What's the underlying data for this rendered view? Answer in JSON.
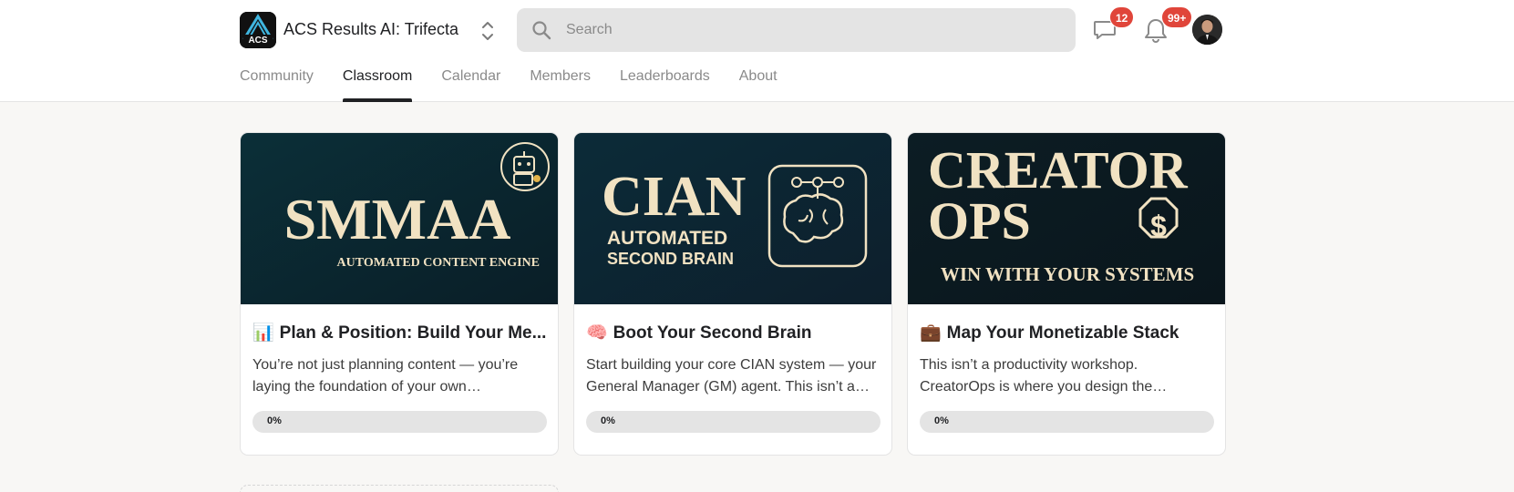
{
  "header": {
    "group_name": "ACS Results AI: Trifecta",
    "logo_text": "ACS",
    "search": {
      "placeholder": "Search",
      "value": ""
    },
    "chat_badge": "12",
    "notification_badge": "99+"
  },
  "tabs": [
    {
      "label": "Community",
      "active": false
    },
    {
      "label": "Classroom",
      "active": true
    },
    {
      "label": "Calendar",
      "active": false
    },
    {
      "label": "Members",
      "active": false
    },
    {
      "label": "Leaderboards",
      "active": false
    },
    {
      "label": "About",
      "active": false
    }
  ],
  "courses": [
    {
      "emoji": "📊",
      "title": "Plan & Position: Build Your Me...",
      "description": "You’re not just planning content — you’re laying the foundation of your own…",
      "progress_label": "0%",
      "progress": 0,
      "cover": {
        "headline": "SMMAA",
        "subline": "AUTOMATED CONTENT ENGINE",
        "icon": "robot-icon"
      }
    },
    {
      "emoji": "🧠",
      "title": "Boot Your Second Brain",
      "description": "Start building your core CIAN system — your General Manager (GM) agent. This isn’t a…",
      "progress_label": "0%",
      "progress": 0,
      "cover": {
        "headline": "CIAN",
        "subline_1": "AUTOMATED",
        "subline_2": "SECOND BRAIN",
        "icon": "brain-icon"
      }
    },
    {
      "emoji": "💼",
      "title": "Map Your Monetizable Stack",
      "description": "This isn’t a productivity workshop. CreatorOps is where you design the busines…",
      "progress_label": "0%",
      "progress": 0,
      "cover": {
        "headline_1": "CREATOR",
        "headline_2": "OPS",
        "subline": "WIN WITH YOUR SYSTEMS",
        "icon": "dollar-shield-icon"
      }
    }
  ],
  "colors": {
    "accent": "#202124",
    "badge": "#e0453a",
    "cover_text": "#f1e2c2",
    "cover_bg_1": "#0c2a33",
    "cover_bg_2": "#0d2431",
    "cover_bg_3": "#0c1a22"
  }
}
